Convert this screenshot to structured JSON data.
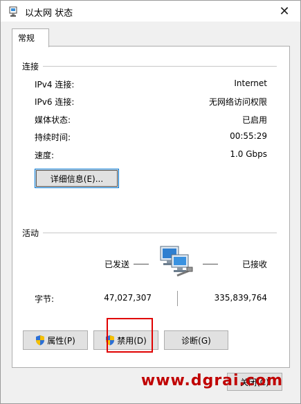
{
  "window": {
    "title": "以太网 状态"
  },
  "tabs": [
    {
      "label": "常规"
    }
  ],
  "connection": {
    "label": "连接",
    "rows": [
      {
        "label": "IPv4 连接:",
        "value": "Internet"
      },
      {
        "label": "IPv6 连接:",
        "value": "无网络访问权限"
      },
      {
        "label": "媒体状态:",
        "value": "已启用"
      },
      {
        "label": "持续时间:",
        "value": "00:55:29"
      },
      {
        "label": "速度:",
        "value": "1.0 Gbps"
      }
    ],
    "details_button": "详细信息(E)..."
  },
  "activity": {
    "label": "活动",
    "sent_label": "已发送",
    "received_label": "已接收",
    "bytes_label": "字节:",
    "bytes_sent": "47,027,307",
    "bytes_received": "335,839,764"
  },
  "buttons": {
    "properties": "属性(P)",
    "disable": "禁用(D)",
    "diagnose": "诊断(G)",
    "close": "关闭(C)"
  },
  "watermark": "www.dgrai.com",
  "icons": {
    "app": "network-adapter-icon",
    "close": "close-icon",
    "network": "network-computers-icon",
    "shield": "uac-shield-icon"
  },
  "colors": {
    "highlight": "#e00000",
    "watermark": "#c00000",
    "focus": "#0078d7"
  }
}
